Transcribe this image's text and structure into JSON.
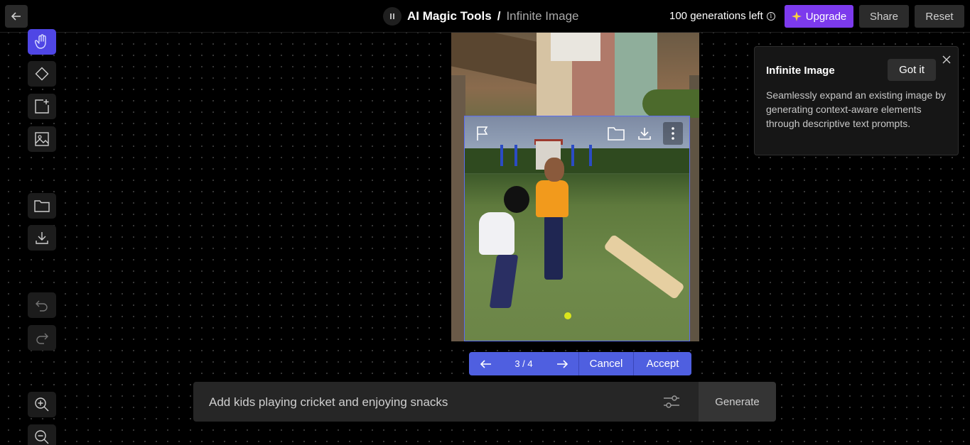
{
  "header": {
    "app_title": "AI Magic Tools",
    "separator": "/",
    "tool_title": "Infinite Image",
    "generations_left": "100 generations left",
    "info_glyph": "i",
    "upgrade_label": "Upgrade",
    "share_label": "Share",
    "reset_label": "Reset"
  },
  "toolbar": {
    "tools": [
      "hand-icon",
      "eraser-icon",
      "add-frame-icon",
      "image-icon",
      "folder-icon",
      "download-icon",
      "undo-icon",
      "redo-icon",
      "zoom-in-icon",
      "zoom-out-icon"
    ]
  },
  "pager": {
    "count": "3 / 4",
    "cancel_label": "Cancel",
    "accept_label": "Accept"
  },
  "prompt": {
    "text": "Add kids playing cricket and enjoying snacks",
    "generate_label": "Generate"
  },
  "popup": {
    "title": "Infinite Image",
    "got_it_label": "Got it",
    "description": "Seamlessly expand an existing image by generating context-aware elements through descriptive text prompts."
  },
  "colors": {
    "accent": "#4f5fe0",
    "upgrade": "#7c3aed",
    "background": "#000000"
  }
}
